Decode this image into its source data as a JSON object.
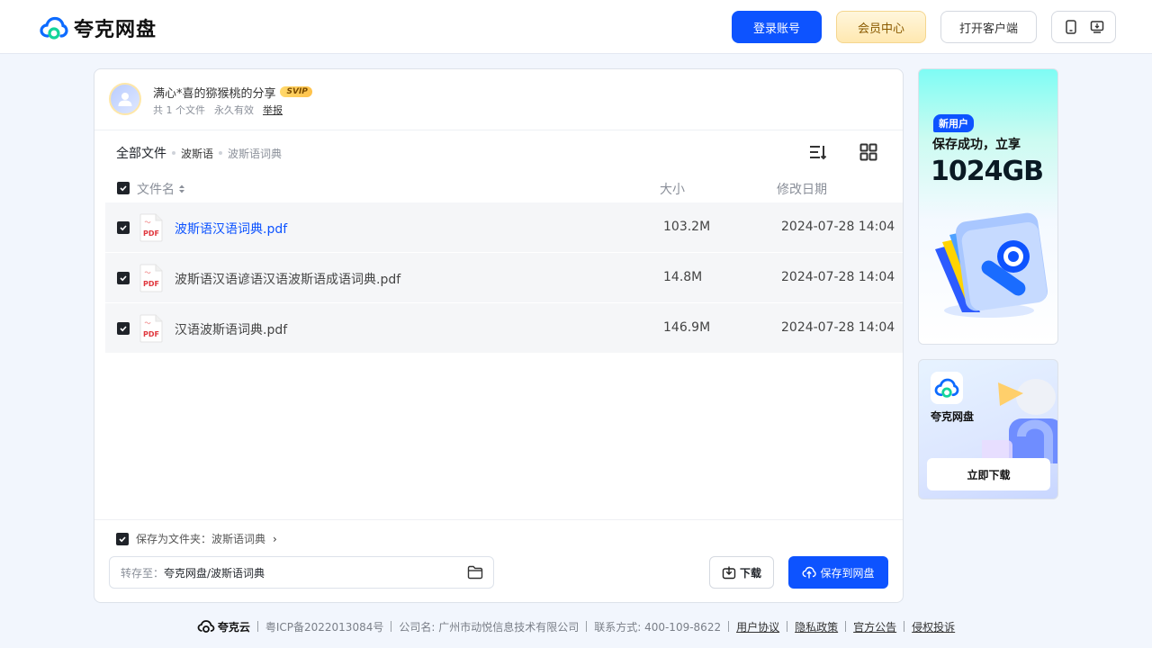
{
  "header": {
    "brand": "夸克网盘",
    "login_label": "登录账号",
    "vip_label": "会员中心",
    "client_label": "打开客户端",
    "icons": [
      "phone-icon",
      "desktop-download-icon"
    ]
  },
  "share": {
    "owner_title": "满心*喜的猕猴桃的分享",
    "badge": "SVIP",
    "file_count": "共 1 个文件",
    "validity": "永久有效",
    "report": "举报"
  },
  "breadcrumb": {
    "all": "全部文件",
    "level1": "波斯语",
    "current": "波斯语词典"
  },
  "table": {
    "columns": {
      "name": "文件名",
      "size": "大小",
      "date": "修改日期"
    },
    "rows": [
      {
        "name": "波斯语汉语词典.pdf",
        "size": "103.2M",
        "date": "2024-07-28 14:04",
        "type": "PDF"
      },
      {
        "name": "波斯语汉语谚语汉语波斯语成语词典.pdf",
        "size": "14.8M",
        "date": "2024-07-28 14:04",
        "type": "PDF"
      },
      {
        "name": "汉语波斯语词典.pdf",
        "size": "146.9M",
        "date": "2024-07-28 14:04",
        "type": "PDF"
      }
    ]
  },
  "footer_actions": {
    "save_as_folder": "保存为文件夹：波斯语词典",
    "arrow": "›",
    "dest_label": "转存至：",
    "dest_value": "夸克网盘/波斯语词典",
    "download_label": "下载",
    "save_label": "保存到网盘"
  },
  "ads": {
    "ad1_badge": "新用户",
    "ad1_line1": "保存成功，立享",
    "ad1_line2": "1024GB",
    "ad2_name": "夸克网盘",
    "ad2_button": "立即下载"
  },
  "site_footer": {
    "brand": "夸克云",
    "icp": "粤ICP备2022013084号",
    "company": "公司名: 广州市动悦信息技术有限公司",
    "contact": "联系方式: 400-109-8622",
    "links": [
      "用户协议",
      "隐私政策",
      "官方公告",
      "侵权投诉"
    ]
  },
  "colors": {
    "primary": "#0d53ff",
    "vip": "#ffe8b0",
    "text": "#1f2329"
  }
}
